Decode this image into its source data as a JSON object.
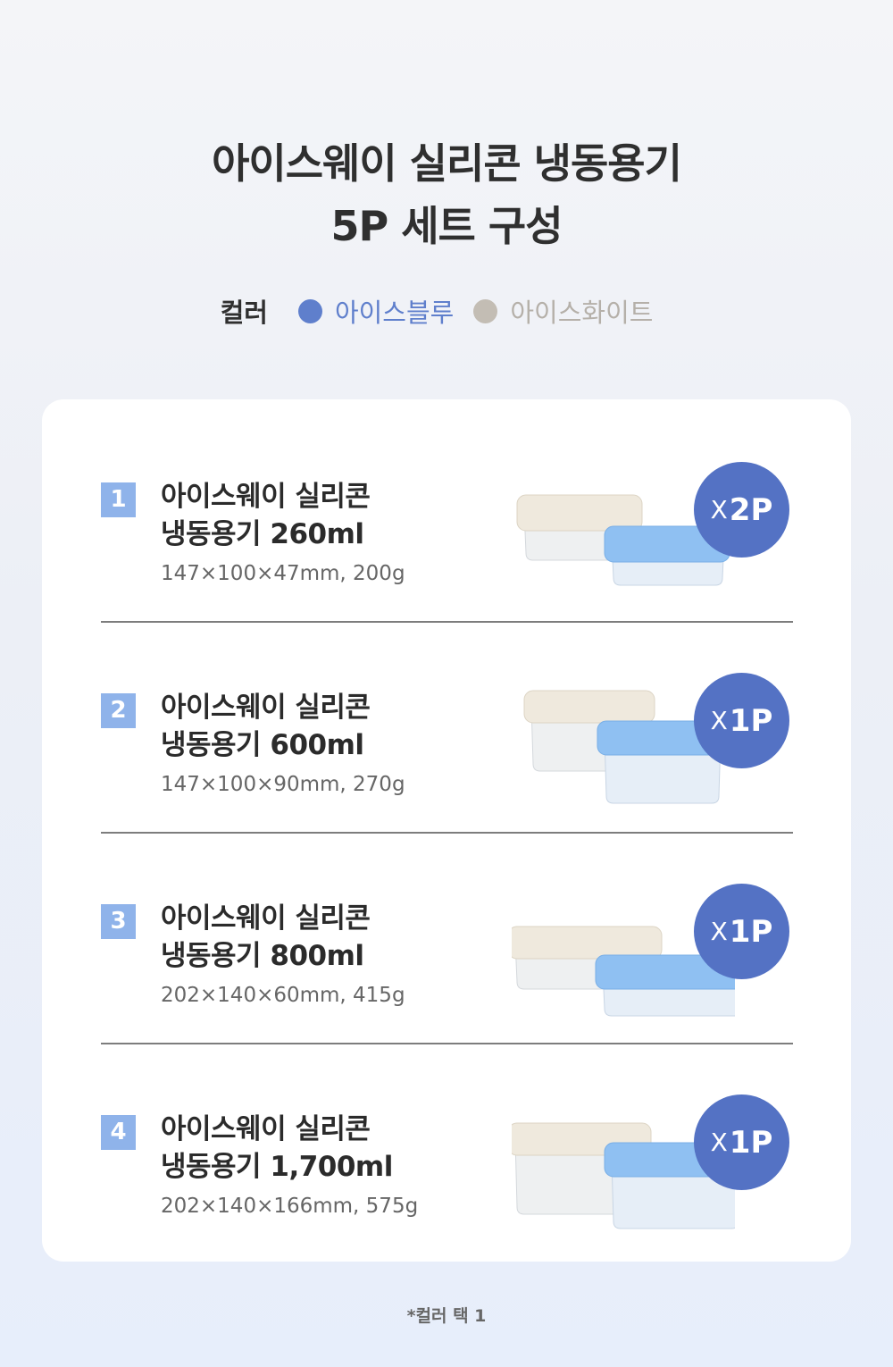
{
  "header": {
    "title_line1": "아이스웨이 실리콘 냉동용기",
    "title_line2": "5P 세트 구성"
  },
  "colors": {
    "label": "컬러",
    "options": [
      {
        "name": "아이스블루",
        "hex": "#5f7fcc",
        "text_color": "#5f7fcc"
      },
      {
        "name": "아이스화이트",
        "hex": "#c3bdb4",
        "text_color": "#b5b0a9"
      }
    ]
  },
  "items": [
    {
      "number": "1",
      "name_line1": "아이스웨이 실리콘",
      "name_line2": "냉동용기 260ml",
      "spec": "147×100×47mm, 200g",
      "qty_prefix": "X",
      "qty": "2P"
    },
    {
      "number": "2",
      "name_line1": "아이스웨이 실리콘",
      "name_line2": "냉동용기 600ml",
      "spec": "147×100×90mm, 270g",
      "qty_prefix": "X",
      "qty": "1P"
    },
    {
      "number": "3",
      "name_line1": "아이스웨이 실리콘",
      "name_line2": "냉동용기 800ml",
      "spec": "202×140×60mm, 415g",
      "qty_prefix": "X",
      "qty": "1P"
    },
    {
      "number": "4",
      "name_line1": "아이스웨이 실리콘",
      "name_line2": "냉동용기 1,700ml",
      "spec": "202×140×166mm, 575g",
      "qty_prefix": "X",
      "qty": "1P"
    }
  ],
  "footnote": "*컬러 택 1",
  "accent": {
    "badge": "#5472c4",
    "number_bg": "#8fb3ea",
    "lid_white": "#efe9dd",
    "lid_blue": "#8fc0f2"
  }
}
